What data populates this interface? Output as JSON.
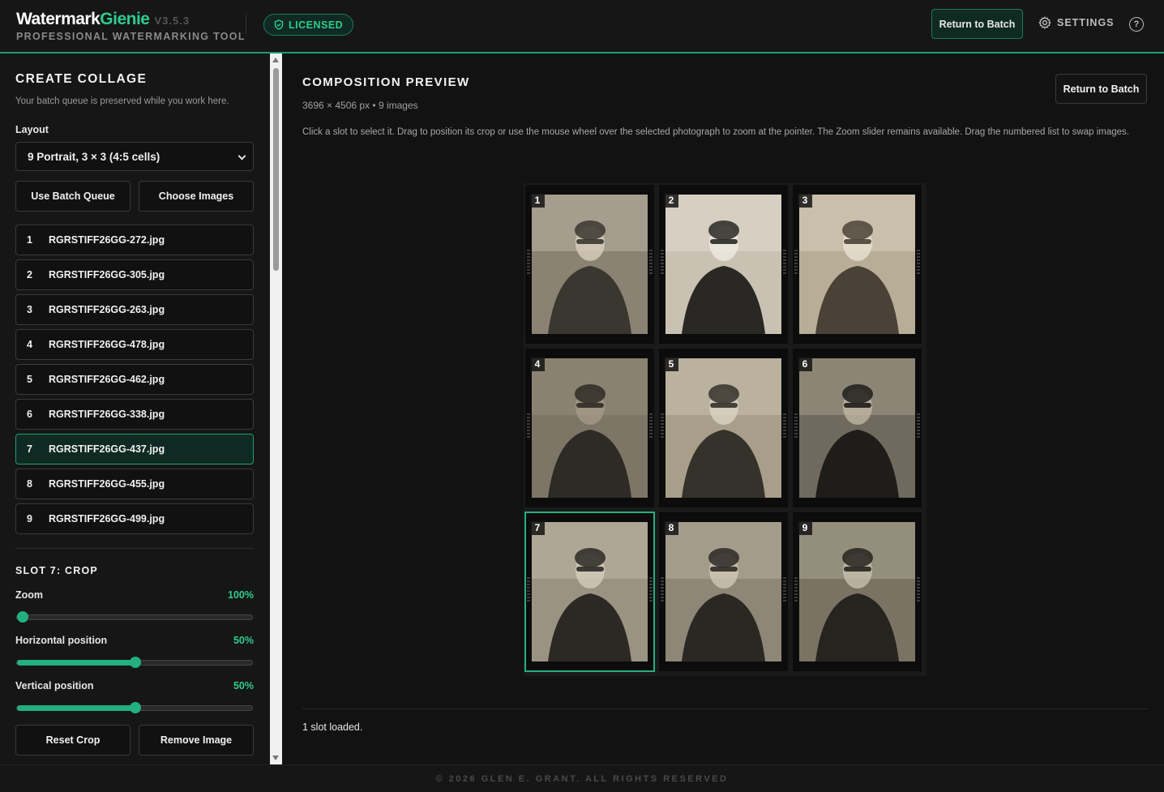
{
  "header": {
    "brand_main": "Watermark",
    "brand_accent": "Gienie",
    "version": "V3.5.3",
    "tagline": "PROFESSIONAL WATERMARKING TOOL",
    "licensed_label": "LICENSED",
    "return_label": "Return to Batch",
    "settings_label": "SETTINGS",
    "help_glyph": "?"
  },
  "sidebar": {
    "title": "CREATE COLLAGE",
    "subtitle": "Your batch queue is preserved while you work here.",
    "layout_label": "Layout",
    "layout_value": "9 Portrait, 3 × 3 (4:5 cells)",
    "use_batch_label": "Use Batch Queue",
    "choose_images_label": "Choose Images",
    "images": [
      {
        "num": "1",
        "name": "RGRSTIFF26GG-272.jpg"
      },
      {
        "num": "2",
        "name": "RGRSTIFF26GG-305.jpg"
      },
      {
        "num": "3",
        "name": "RGRSTIFF26GG-263.jpg"
      },
      {
        "num": "4",
        "name": "RGRSTIFF26GG-478.jpg"
      },
      {
        "num": "5",
        "name": "RGRSTIFF26GG-462.jpg"
      },
      {
        "num": "6",
        "name": "RGRSTIFF26GG-338.jpg"
      },
      {
        "num": "7",
        "name": "RGRSTIFF26GG-437.jpg"
      },
      {
        "num": "8",
        "name": "RGRSTIFF26GG-455.jpg"
      },
      {
        "num": "9",
        "name": "RGRSTIFF26GG-499.jpg"
      }
    ],
    "selected_index": 6,
    "slot_title": "SLOT 7: CROP",
    "zoom_label": "Zoom",
    "zoom_value": "100%",
    "zoom_fraction": 0,
    "hpos_label": "Horizontal position",
    "hpos_value": "50%",
    "hpos_fraction": 0.5,
    "vpos_label": "Vertical position",
    "vpos_value": "50%",
    "vpos_fraction": 0.5,
    "reset_crop_label": "Reset Crop",
    "remove_image_label": "Remove Image"
  },
  "main": {
    "title": "COMPOSITION PREVIEW",
    "dims": "3696 × 4506 px • 9 images",
    "help_text": "Click a slot to select it. Drag to position its crop or use the mouse wheel over the selected photograph to zoom at the pointer. The Zoom slider remains available. Drag the numbered list to swap images.",
    "return_label": "Return to Batch",
    "status": "1 slot loaded."
  },
  "collage": {
    "slots": [
      "1",
      "2",
      "3",
      "4",
      "5",
      "6",
      "7",
      "8",
      "9"
    ],
    "selected_slot": 7
  },
  "footer": {
    "text": "© 2026 GLEN E. GRANT. ALL RIGHTS RESERVED"
  },
  "colors": {
    "accent": "#2ecc8f",
    "accent_dark": "#0f2a22",
    "background": "#121212"
  }
}
